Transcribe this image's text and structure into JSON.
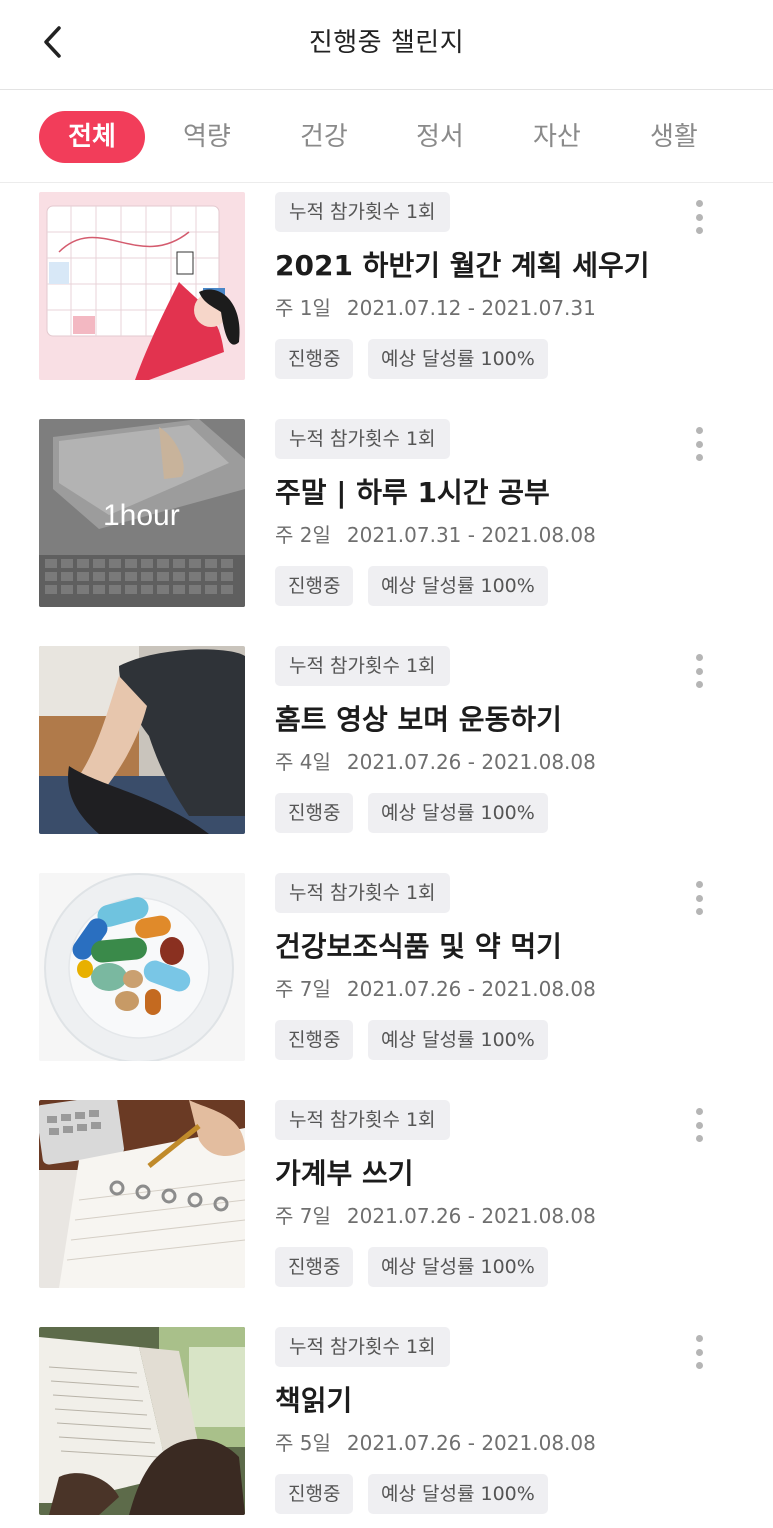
{
  "header": {
    "title": "진행중 챌린지",
    "back_icon": "chevron-left-icon"
  },
  "tabs": [
    {
      "label": "전체",
      "active": true
    },
    {
      "label": "역량",
      "active": false
    },
    {
      "label": "건강",
      "active": false
    },
    {
      "label": "정서",
      "active": false
    },
    {
      "label": "자산",
      "active": false
    },
    {
      "label": "생활",
      "active": false
    }
  ],
  "colors": {
    "accent": "#f23d5a",
    "badge_bg": "#efeff2",
    "text_muted": "#6f6f6f"
  },
  "challenges": [
    {
      "count_badge": "누적 참가횟수 1회",
      "title": "2021 하반기 월간 계획 세우기",
      "frequency": "주 1일",
      "period": "2021.07.12 - 2021.07.31",
      "status": "진행중",
      "rate": "예상 달성률 100%"
    },
    {
      "count_badge": "누적 참가횟수 1회",
      "title": "주말 | 하루 1시간 공부",
      "frequency": "주 2일",
      "period": "2021.07.31 - 2021.08.08",
      "status": "진행중",
      "rate": "예상 달성률 100%",
      "thumb_text": "1hour"
    },
    {
      "count_badge": "누적 참가횟수 1회",
      "title": "홈트 영상 보며 운동하기",
      "frequency": "주 4일",
      "period": "2021.07.26 - 2021.08.08",
      "status": "진행중",
      "rate": "예상 달성률 100%"
    },
    {
      "count_badge": "누적 참가횟수 1회",
      "title": "건강보조식품 및 약  먹기",
      "frequency": "주 7일",
      "period": "2021.07.26 - 2021.08.08",
      "status": "진행중",
      "rate": "예상 달성률 100%"
    },
    {
      "count_badge": "누적 참가횟수 1회",
      "title": "가계부 쓰기",
      "frequency": "주 7일",
      "period": "2021.07.26 - 2021.08.08",
      "status": "진행중",
      "rate": "예상 달성률 100%"
    },
    {
      "count_badge": "누적 참가횟수 1회",
      "title": "책읽기",
      "frequency": "주 5일",
      "period": "2021.07.26 - 2021.08.08",
      "status": "진행중",
      "rate": "예상 달성률 100%"
    }
  ]
}
